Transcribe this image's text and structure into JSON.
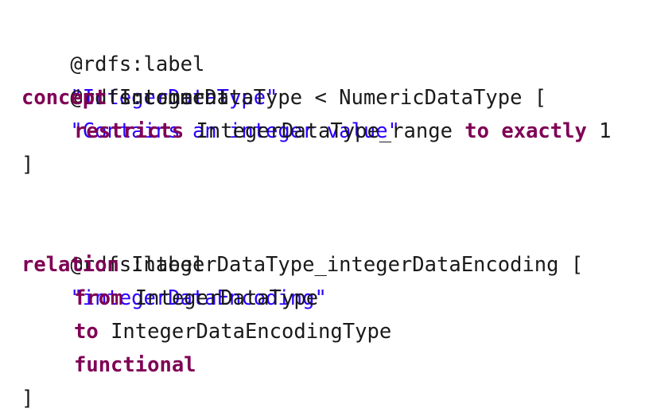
{
  "editor": {
    "colors": {
      "background": "#ffffff",
      "text": "#1a1a1a",
      "keyword": "#7f0055",
      "string": "#2a00ff"
    },
    "lines": {
      "l1": {
        "annotation": "@rdfs:label",
        "value": "\"IntegerDataType\""
      },
      "l2": {
        "annotation": "@rdfs:comment",
        "value": "\"Contains an integer value\""
      },
      "l3": {
        "keyword": "concept",
        "rest": " IntegerDataType < NumericDataType ["
      },
      "l4": {
        "kw1": "restricts",
        "middle": " IntegerDataType_range ",
        "kw2": "to",
        "kw3": "exactly",
        "value": " 1"
      },
      "l5": {
        "text": "]"
      },
      "l7": {
        "annotation": "@rdfs:label",
        "value": "\"integerDataEncoding\""
      },
      "l8": {
        "keyword": "relation",
        "rest": " IntegerDataType_integerDataEncoding ["
      },
      "l9": {
        "keyword": "from",
        "rest": " IntegerDataType"
      },
      "l10": {
        "keyword": "to",
        "rest": " IntegerDataEncodingType"
      },
      "l11": {
        "keyword": "functional"
      },
      "l12": {
        "text": "]"
      }
    }
  }
}
